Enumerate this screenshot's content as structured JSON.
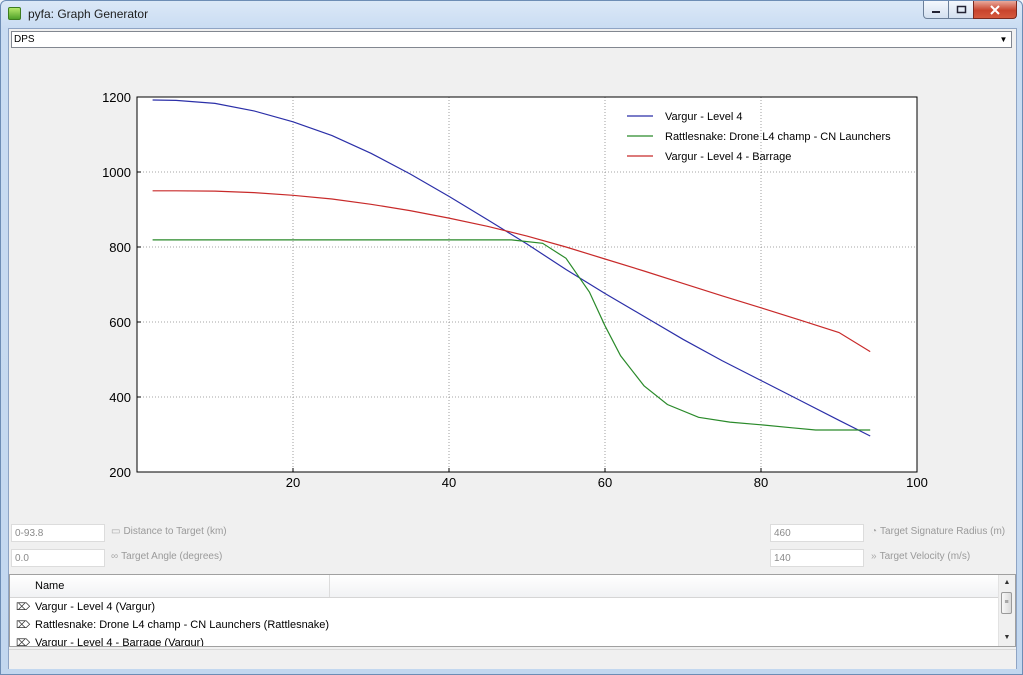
{
  "window": {
    "title": "pyfa: Graph Generator"
  },
  "selector": {
    "value": "DPS"
  },
  "chart_data": {
    "type": "line",
    "title": "",
    "xlabel": "",
    "ylabel": "",
    "xlim": [
      0,
      100
    ],
    "ylim": [
      200,
      1200
    ],
    "x_ticks": [
      20,
      40,
      60,
      80,
      100
    ],
    "y_ticks": [
      200,
      400,
      600,
      800,
      1000,
      1200
    ],
    "grid": true,
    "legend_position": "top-right",
    "series": [
      {
        "name": "Vargur - Level 4",
        "color": "#2b2fa8",
        "x": [
          2,
          5,
          10,
          15,
          20,
          25,
          30,
          35,
          40,
          45,
          50,
          55,
          60,
          65,
          70,
          75,
          80,
          85,
          90,
          94
        ],
        "y": [
          1192,
          1191,
          1183,
          1163,
          1134,
          1097,
          1050,
          995,
          935,
          872,
          808,
          740,
          676,
          615,
          554,
          497,
          444,
          391,
          338,
          296
        ]
      },
      {
        "name": "Rattlesnake: Drone L4 champ - CN Launchers",
        "color": "#2a8a2a",
        "x": [
          2,
          10,
          20,
          30,
          40,
          48,
          52,
          55,
          58,
          60,
          62,
          65,
          68,
          72,
          76,
          80,
          84,
          87,
          90,
          94
        ],
        "y": [
          819,
          819,
          819,
          819,
          819,
          819,
          810,
          770,
          680,
          590,
          510,
          430,
          380,
          346,
          333,
          326,
          318,
          312,
          312,
          312
        ]
      },
      {
        "name": "Vargur - Level 4 - Barrage",
        "color": "#c82a2a",
        "x": [
          2,
          5,
          10,
          15,
          20,
          25,
          30,
          35,
          40,
          45,
          50,
          55,
          60,
          65,
          70,
          75,
          80,
          85,
          90,
          94
        ],
        "y": [
          950,
          950,
          949,
          945,
          938,
          928,
          914,
          897,
          877,
          855,
          829,
          800,
          768,
          736,
          703,
          670,
          638,
          605,
          572,
          521
        ]
      }
    ]
  },
  "params": {
    "distance": {
      "value": "0-93.8",
      "label": "Distance to Target (km)"
    },
    "angle": {
      "value": "0.0",
      "label": "Target Angle (degrees)"
    },
    "signature": {
      "value": "460",
      "label": "Target Signature Radius (m)"
    },
    "velocity": {
      "value": "140",
      "label": "Target Velocity (m/s)"
    }
  },
  "fitlist": {
    "header": "Name",
    "items": [
      {
        "label": "Vargur - Level 4 (Vargur)"
      },
      {
        "label": "Rattlesnake: Drone L4 champ - CN Launchers (Rattlesnake)"
      },
      {
        "label": "Vargur - Level 4 - Barrage (Vargur)"
      }
    ]
  },
  "colors": {
    "title_bar": "#c9dcf2",
    "client": "#f0f0f0",
    "close": "#c8442d"
  },
  "icons": {
    "app": "app-icon",
    "fit": "ship-icon",
    "distance": "ruler-icon",
    "angle": "angle-icon",
    "signature": "signature-icon",
    "velocity": "velocity-icon"
  }
}
